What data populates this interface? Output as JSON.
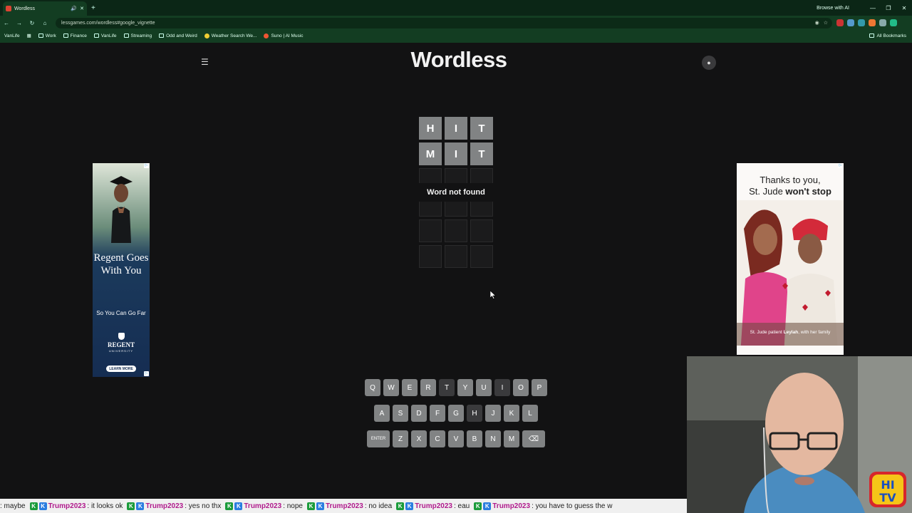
{
  "browser": {
    "tab_title": "Wordless",
    "new_tab_symbol": "+",
    "browse_ai": "Browse with AI",
    "url": "lessgames.com/wordless#google_vignette",
    "bookmarks": [
      "VanLife",
      "Work",
      "Finance",
      "VanLife",
      "Streaming",
      "Odd and Weird",
      "Weather Search We...",
      "Suno | AI Music"
    ],
    "all_bookmarks": "All Bookmarks"
  },
  "site": {
    "logo": "Wordless"
  },
  "board": {
    "rows": [
      [
        "H",
        "I",
        "T"
      ],
      [
        "M",
        "I",
        "T"
      ],
      [
        "",
        "",
        ""
      ],
      [
        "",
        "",
        ""
      ],
      [
        "",
        "",
        ""
      ],
      [
        "",
        "",
        ""
      ]
    ],
    "toast": "Word not found"
  },
  "keyboard": {
    "row1": [
      "Q",
      "W",
      "E",
      "R",
      "T",
      "Y",
      "U",
      "I",
      "O",
      "P"
    ],
    "row2": [
      "A",
      "S",
      "D",
      "F",
      "G",
      "H",
      "J",
      "K",
      "L"
    ],
    "row3": [
      "ENTER",
      "Z",
      "X",
      "C",
      "V",
      "B",
      "N",
      "M",
      "⌫"
    ],
    "dark_keys": [
      "T",
      "I",
      "H"
    ]
  },
  "ad_left": {
    "headline": "Regent Goes With You",
    "subline": "So You Can Go Far",
    "brand": "REGENT",
    "brand_sub": "UNIVERSITY",
    "cta": "LEARN MORE"
  },
  "ad_right": {
    "line1": "Thanks to you,",
    "line2_prefix": "St. Jude ",
    "line2_bold": "won't stop",
    "caption_prefix": "St. Jude patient ",
    "caption_name": "Leylah",
    "caption_suffix": ", with her family"
  },
  "ticker": {
    "lead": ": maybe",
    "items": [
      {
        "user": "Trump2023",
        "text": ": it looks ok"
      },
      {
        "user": "Trump2023",
        "text": ": yes no thx"
      },
      {
        "user": "Trump2023",
        "text": ": nope"
      },
      {
        "user": "Trump2023",
        "text": ": no idea"
      },
      {
        "user": "Trump2023",
        "text": ": eau"
      },
      {
        "user": "Trump2023",
        "text": ": you have to guess the w"
      }
    ]
  },
  "colors": {
    "page_bg": "#121213",
    "tile_filled": "#818384",
    "key_dark": "#3a3a3c",
    "chrome": "#133d22"
  }
}
